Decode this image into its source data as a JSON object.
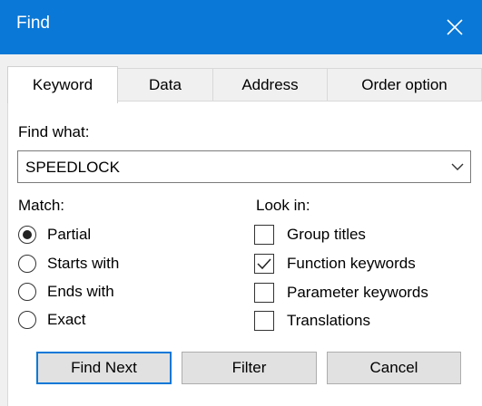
{
  "window": {
    "title": "Find"
  },
  "tabs": [
    {
      "label": "Keyword",
      "active": true
    },
    {
      "label": "Data",
      "active": false
    },
    {
      "label": "Address",
      "active": false
    },
    {
      "label": "Order option",
      "active": false
    }
  ],
  "find_what": {
    "label": "Find what:",
    "value": "SPEEDLOCK"
  },
  "match": {
    "label": "Match:",
    "options": [
      {
        "label": "Partial",
        "selected": true
      },
      {
        "label": "Starts with",
        "selected": false
      },
      {
        "label": "Ends with",
        "selected": false
      },
      {
        "label": "Exact",
        "selected": false
      }
    ]
  },
  "look_in": {
    "label": "Look in:",
    "options": [
      {
        "label": "Group titles",
        "checked": false
      },
      {
        "label": "Function keywords",
        "checked": true
      },
      {
        "label": "Parameter keywords",
        "checked": false
      },
      {
        "label": "Translations",
        "checked": false
      }
    ]
  },
  "buttons": {
    "find_next": "Find Next",
    "filter": "Filter",
    "cancel": "Cancel"
  },
  "colors": {
    "title_bar": "#0a78d7",
    "dialog_bg": "#f0f0f0",
    "panel_bg": "#ffffff",
    "button_bg": "#e1e1e1",
    "default_button_border": "#0a78d7"
  },
  "icons": {
    "close": "close-icon",
    "dropdown": "chevron-down-icon",
    "check": "checkmark-icon"
  }
}
